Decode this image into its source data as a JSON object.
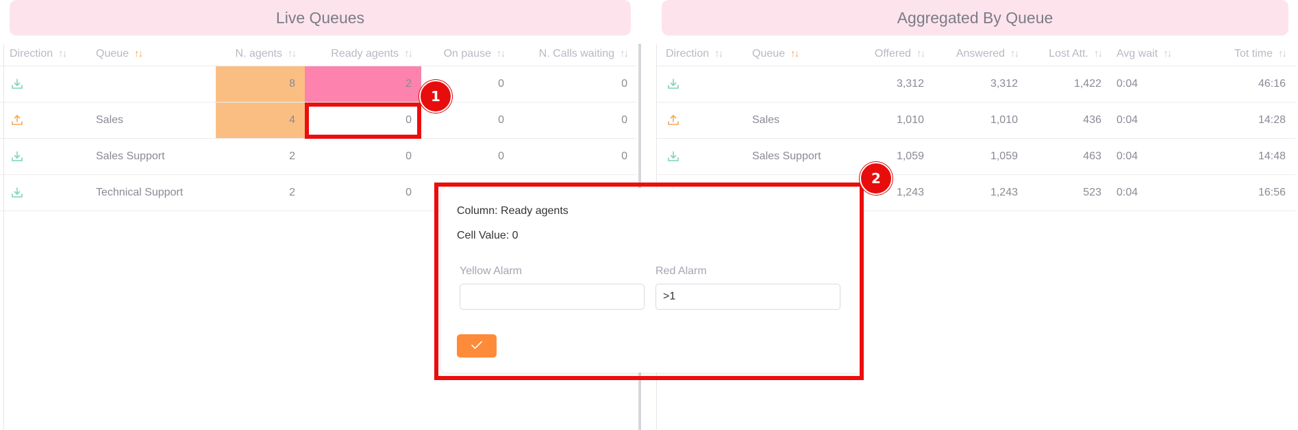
{
  "live": {
    "title": "Live Queues",
    "columns": [
      "Direction",
      "Queue",
      "N. agents",
      "Ready agents",
      "On pause",
      "N. Calls waiting"
    ],
    "rows": [
      {
        "direction": "inbound",
        "queue": "",
        "agents": "8",
        "ready": "2",
        "pause": "0",
        "waiting": "0"
      },
      {
        "direction": "outbound",
        "queue": "Sales",
        "agents": "4",
        "ready": "0",
        "pause": "0",
        "waiting": "0"
      },
      {
        "direction": "inbound",
        "queue": "Sales Support",
        "agents": "2",
        "ready": "0",
        "pause": "0",
        "waiting": "0"
      },
      {
        "direction": "inbound",
        "queue": "Technical Support",
        "agents": "2",
        "ready": "0",
        "pause": "",
        "waiting": ""
      }
    ]
  },
  "aggregated": {
    "title": "Aggregated By Queue",
    "columns": [
      "Direction",
      "Queue",
      "Offered",
      "Answered",
      "Lost Att.",
      "Avg wait",
      "Tot time"
    ],
    "rows": [
      {
        "direction": "inbound",
        "queue": "",
        "offered": "3,312",
        "answered": "3,312",
        "lost": "1,422",
        "avg": "0:04",
        "tot": "46:16"
      },
      {
        "direction": "outbound",
        "queue": "Sales",
        "offered": "1,010",
        "answered": "1,010",
        "lost": "436",
        "avg": "0:04",
        "tot": "14:28"
      },
      {
        "direction": "inbound",
        "queue": "Sales Support",
        "offered": "1,059",
        "answered": "1,059",
        "lost": "463",
        "avg": "0:04",
        "tot": "14:48"
      },
      {
        "direction": "inbound",
        "queue": "",
        "offered": "1,243",
        "answered": "1,243",
        "lost": "523",
        "avg": "0:04",
        "tot": "16:56"
      }
    ]
  },
  "popup": {
    "column_line": "Column: Ready agents",
    "value_line": "Cell Value: 0",
    "yellow_label": "Yellow Alarm",
    "yellow_value": "",
    "red_label": "Red Alarm",
    "red_value": ">1"
  },
  "badges": {
    "one": "1",
    "two": "2"
  },
  "colors": {
    "header_bg": "#fde4ec",
    "agents_cell": "#fbbe82",
    "ready_cell_alarm": "#fd82ad",
    "confirm_button": "#fd8b39",
    "highlight": "#ec0d0d",
    "inbound_icon": "#7dd4b7",
    "outbound_icon": "#f3a85c"
  },
  "icons": {
    "inbound": "download-icon",
    "outbound": "upload-icon",
    "confirm": "check-icon",
    "sort": "sort-arrows-icon"
  }
}
